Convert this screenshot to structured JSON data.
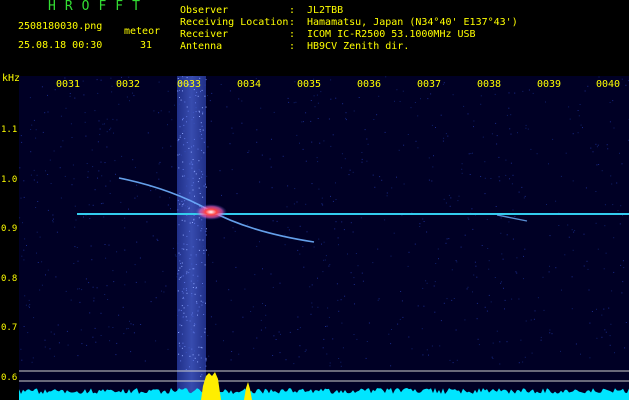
{
  "header": {
    "app_title": "HROFFT",
    "filename": "2508180030.png",
    "datetime": "25.08.18 00:30",
    "meteor_label": "meteor",
    "meteor_count": "31"
  },
  "station_info": [
    {
      "key": "Observer",
      "sep": ":",
      "value": "JL2TBB"
    },
    {
      "key": "Receiving Location",
      "sep": ":",
      "value": "Hamamatsu, Japan (N34°40' E137°43')"
    },
    {
      "key": "Receiver",
      "sep": ":",
      "value": "ICOM IC-R2500 53.1000MHz USB"
    },
    {
      "key": "Antenna",
      "sep": ":",
      "value": "HB9CV Zenith dir."
    }
  ],
  "spectrogram": {
    "unit_label": "kHz",
    "y_tick_labels": [
      "1.1",
      "1.0",
      "0.9",
      "0.8",
      "0.7",
      "0.6"
    ],
    "x_tick_labels": [
      "0031",
      "0032",
      "0033",
      "0034",
      "0035",
      "0036",
      "0037",
      "0038",
      "0039",
      "0040"
    ],
    "colors": {
      "background": "#000025",
      "label": "#ffff00",
      "carrier": "#33ccee",
      "burst": "#3355cc",
      "baseline": "#00ffff"
    }
  }
}
